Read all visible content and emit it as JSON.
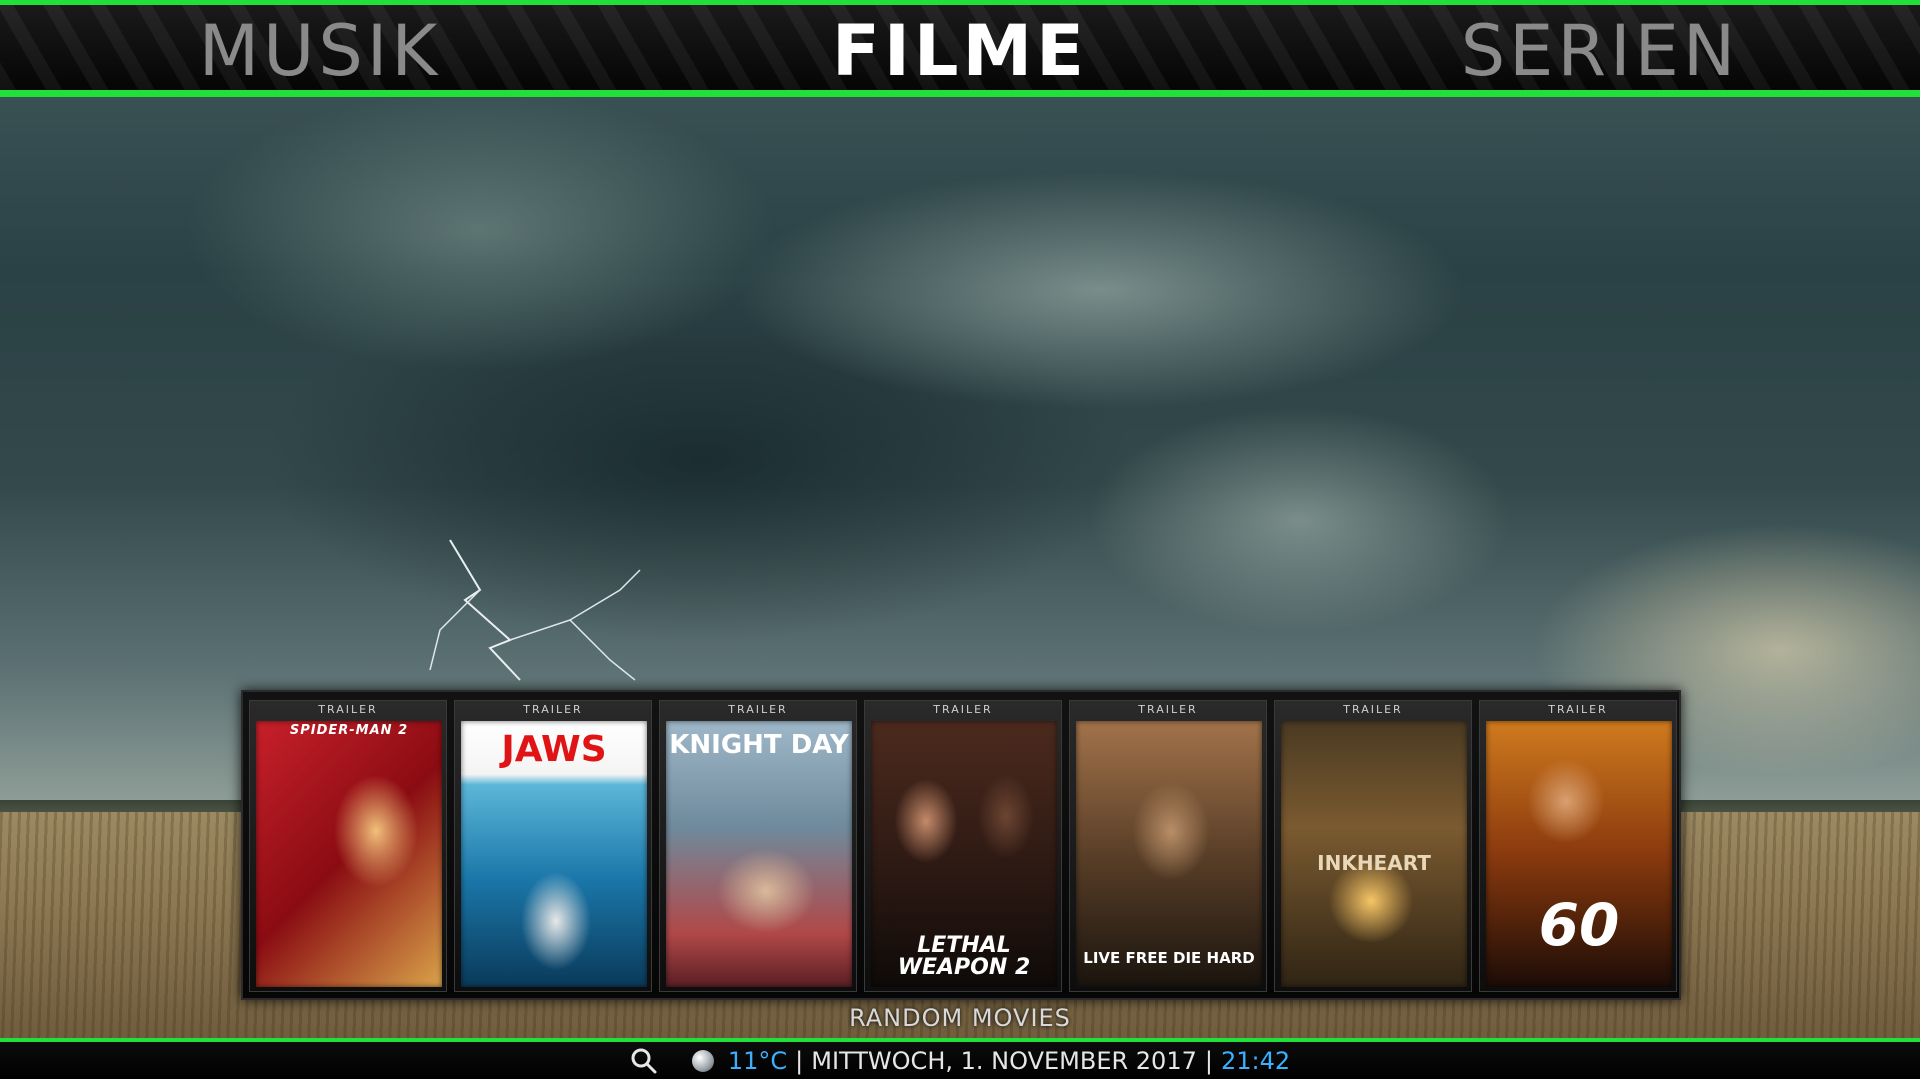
{
  "nav": {
    "left": "MUSIK",
    "center": "FILME",
    "right": "SERIEN"
  },
  "shelf": {
    "caption": "RANDOM MOVIES",
    "items": [
      {
        "label": "TRAILER",
        "poster_title": "SPIDER-MAN 2"
      },
      {
        "label": "TRAILER",
        "poster_title": "JAWS"
      },
      {
        "label": "TRAILER",
        "poster_title": "KNIGHT DAY"
      },
      {
        "label": "TRAILER",
        "poster_title": "LETHAL WEAPON 2"
      },
      {
        "label": "TRAILER",
        "poster_title": "LIVE FREE DIE HARD"
      },
      {
        "label": "TRAILER",
        "poster_title": "INKHEART"
      },
      {
        "label": "TRAILER",
        "poster_title": "60"
      }
    ]
  },
  "status": {
    "temperature": "11°C",
    "date": "MITTWOCH, 1. NOVEMBER 2017",
    "time": "21:42",
    "separator": "|"
  },
  "icons": {
    "search": "search-icon",
    "weather": "weather-icon"
  },
  "colors": {
    "accent": "#22e03a",
    "highlight": "#3ab0ff"
  }
}
